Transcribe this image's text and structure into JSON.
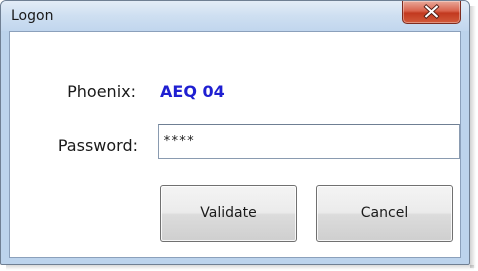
{
  "window": {
    "title": "Logon",
    "close_label": "X"
  },
  "form": {
    "phoenix_label": "Phoenix:",
    "phoenix_value": "AEQ 04",
    "password_label": "Password:",
    "password_value": "****"
  },
  "buttons": {
    "validate_label": "Validate",
    "cancel_label": "Cancel"
  },
  "colors": {
    "phoenix_value": "#1f1fd1",
    "close_button": "#c2391f",
    "frame": "#bcd3ec"
  },
  "icons": {
    "close": "close-icon"
  }
}
